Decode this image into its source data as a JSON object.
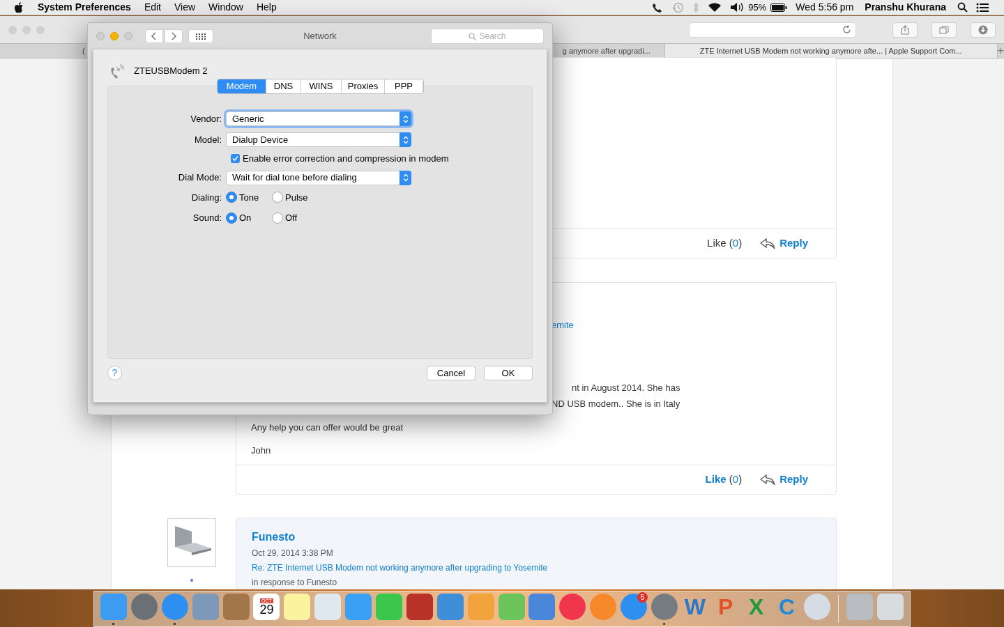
{
  "menu_bar": {
    "app": "System Preferences",
    "menus": [
      "Edit",
      "View",
      "Window",
      "Help"
    ],
    "battery": "95%",
    "clock": "Wed 5:56 pm",
    "user": "Pranshu Khurana"
  },
  "browser": {
    "tabs": [
      {
        "label": "(",
        "selected": false
      },
      {
        "label": "g anymore after upgradi...",
        "selected": false
      },
      {
        "label": "ZTE Internet USB Modem not working anymore afte... | Apple Support Com...",
        "selected": true
      }
    ],
    "new_tab": "+",
    "posts": [
      {
        "like": "Like",
        "paren_open": "(",
        "like_count": "0",
        "paren_close": ")",
        "liked_style": false,
        "reply": "Reply"
      },
      {
        "link": "emite",
        "lines": [
          "nt in August 2014. She has",
          "ND USB modem.. She is in Italy",
          "Any help you can offer would be great",
          "John"
        ],
        "like": "Like",
        "paren_open": "(",
        "like_count": "0",
        "paren_close": ")",
        "liked_style": true,
        "reply": "Reply"
      }
    ],
    "last_post": {
      "author": "Funesto",
      "date": "Oct 29, 2014 3:38 PM",
      "title": "Re: ZTE Internet USB Modem not working anymore after upgrading to Yosemite",
      "note": "in response to Funesto"
    }
  },
  "dialog": {
    "title": "Network",
    "search_placeholder": "Search",
    "device": "ZTEUSBModem 2",
    "tabs": [
      {
        "label": "Modem",
        "selected": true
      },
      {
        "label": "DNS",
        "selected": false
      },
      {
        "label": "WINS",
        "selected": false
      },
      {
        "label": "Proxies",
        "selected": false
      },
      {
        "label": "PPP",
        "selected": false
      }
    ],
    "vendor": {
      "label": "Vendor:",
      "value": "Generic",
      "focused": true
    },
    "model": {
      "label": "Model:",
      "value": "Dialup Device",
      "focused": false
    },
    "error_correction": {
      "label": "Enable error correction and compression in modem",
      "checked": true
    },
    "dial_mode": {
      "label": "Dial Mode:",
      "value": "Wait for dial tone before dialing",
      "focused": false
    },
    "dialing": {
      "label": "Dialing:",
      "options": [
        {
          "label": "Tone",
          "selected": true
        },
        {
          "label": "Pulse",
          "selected": false
        }
      ]
    },
    "sound": {
      "label": "Sound:",
      "options": [
        {
          "label": "On",
          "selected": true
        },
        {
          "label": "Off",
          "selected": false
        }
      ]
    },
    "help": "?",
    "cancel": "Cancel",
    "ok": "OK"
  },
  "dock": [
    {
      "running": true
    },
    {
      "running": false
    },
    {
      "running": true
    },
    {
      "running": false
    },
    {
      "running": false
    },
    {
      "running": false,
      "month": "OCT",
      "day": "29"
    },
    {
      "running": false
    },
    {
      "running": false
    },
    {
      "running": false
    },
    {
      "running": false
    },
    {
      "running": false
    },
    {
      "running": false
    },
    {
      "running": false
    },
    {
      "running": false
    },
    {
      "running": false
    },
    {
      "running": false
    },
    {
      "running": false
    },
    {
      "running": false,
      "badge": "5"
    },
    {
      "running": true
    },
    {
      "running": false,
      "glyph": "W"
    },
    {
      "running": false,
      "glyph": "P"
    },
    {
      "running": false,
      "glyph": "X"
    },
    {
      "running": false,
      "glyph": "C"
    },
    {
      "running": false
    },
    {
      "running": false
    },
    {
      "running": false
    }
  ]
}
